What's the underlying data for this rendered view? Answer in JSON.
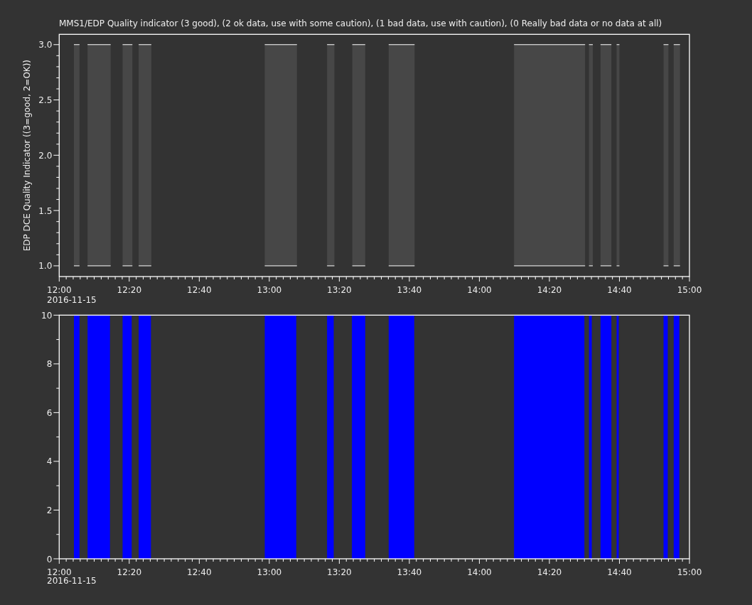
{
  "title": "MMS1/EDP  Quality indicator (3 good), (2 ok data, use with some caution), (1 bad data, use with caution), (0 Really bad data or no data at all)",
  "plots": [
    {
      "kind": "band",
      "y_axis_label": "EDP DCE Quality Indicator ((3=good, 2=OK))",
      "x_tick_labels": [
        "12:00",
        "12:20",
        "12:40",
        "13:00",
        "13:20",
        "13:40",
        "14:00",
        "14:20",
        "14:40",
        "15:00"
      ],
      "date_label": "2016-11-15",
      "y_tick_labels": [
        "3.0",
        "2.5",
        "2.0",
        "1.5",
        "1.0"
      ]
    },
    {
      "kind": "fill",
      "x_tick_labels": [
        "12:00",
        "12:20",
        "12:40",
        "13:00",
        "13:20",
        "13:40",
        "14:00",
        "14:20",
        "14:40",
        "15:00"
      ],
      "date_label": "2016-11-15",
      "y_tick_labels": [
        "10",
        "8",
        "6",
        "4",
        "2",
        "0"
      ]
    }
  ]
}
